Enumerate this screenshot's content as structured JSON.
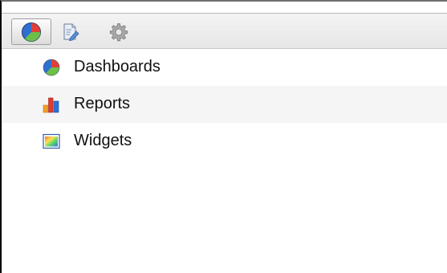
{
  "toolbar": {
    "buttons": [
      {
        "icon": "dashboards-pie-icon",
        "active": true
      },
      {
        "icon": "report-edit-icon",
        "active": false
      },
      {
        "icon": "gear-icon",
        "active": false
      }
    ]
  },
  "tree": {
    "items": [
      {
        "label": "Dashboards",
        "icon": "pie-chart-icon"
      },
      {
        "label": "Reports",
        "icon": "bar-chart-icon"
      },
      {
        "label": "Widgets",
        "icon": "widget-gradient-icon"
      }
    ]
  },
  "colors": {
    "pie_blue": "#2f6fd0",
    "pie_red": "#e0403a",
    "pie_green": "#6cc04a",
    "bar_red": "#e23b2e",
    "bar_orange": "#f0a12a",
    "bar_blue": "#2b72d6",
    "row_alt": "#f5f5f5"
  }
}
